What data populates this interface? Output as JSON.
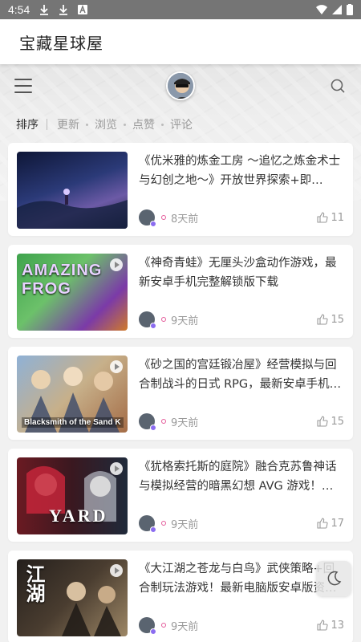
{
  "status_bar": {
    "time": "4:54"
  },
  "app": {
    "title": "宝藏星球屋"
  },
  "sort_bar": {
    "active": "排序",
    "options": [
      "更新",
      "浏览",
      "点赞",
      "评论"
    ]
  },
  "posts": [
    {
      "title": "《优米雅的炼金工房 ～追忆之炼金术士与幻创之地～》开放世界探索+即…",
      "time": "8天前",
      "likes": "11",
      "thumb_text": "",
      "colors": [
        "#1d2a52",
        "#5b4a8c"
      ]
    },
    {
      "title": "《神奇青蛙》无厘头沙盒动作游戏，最新安卓手机完整解锁版下载",
      "time": "9天前",
      "likes": "15",
      "thumb_text": "AMAZING FROG",
      "colors": [
        "#39a84a",
        "#8a3fb8"
      ]
    },
    {
      "title": "《砂之国的宫廷锻冶屋》经营模拟与回合制战斗的日式 RPG，最新安卓手机…",
      "time": "9天前",
      "likes": "15",
      "thumb_text": "Blacksmith of the Sand K",
      "colors": [
        "#6d8fb5",
        "#c9a066"
      ]
    },
    {
      "title": "《犹格索托斯的庭院》融合克苏鲁神话与模拟经营的暗黑幻想 AVG 游戏！…",
      "time": "9天前",
      "likes": "17",
      "thumb_text": "YARD",
      "colors": [
        "#5a1c25",
        "#1f2a3a"
      ]
    },
    {
      "title": "《大江湖之苍龙与白鸟》武侠策略+回合制玩法游戏！最新电脑版安卓版资…",
      "time": "9天前",
      "likes": "13",
      "thumb_text": "江湖",
      "colors": [
        "#2b2622",
        "#8e7a5c"
      ]
    }
  ]
}
